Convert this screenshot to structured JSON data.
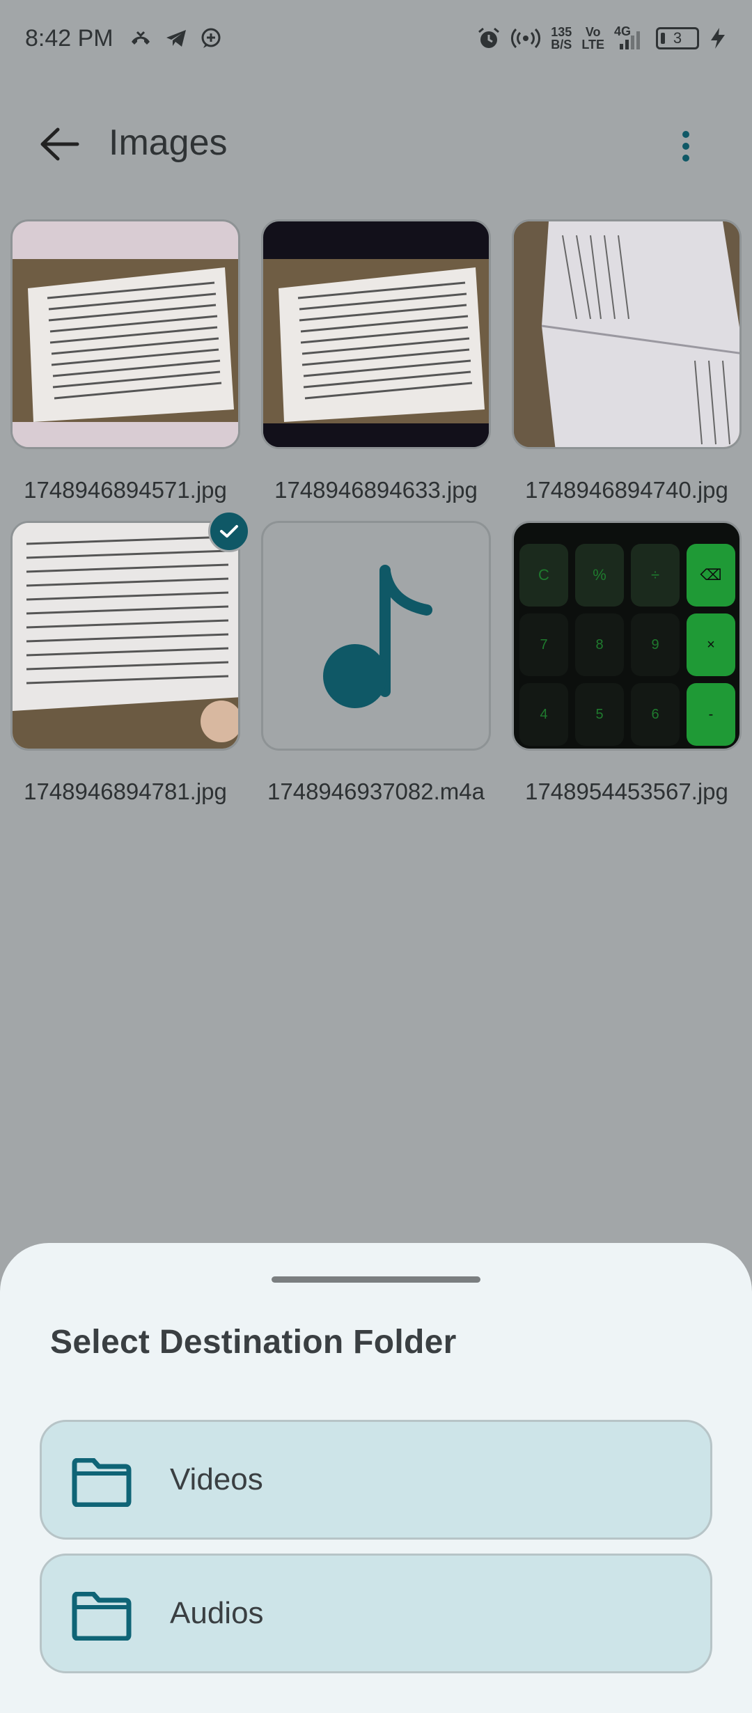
{
  "status_bar": {
    "time": "8:42 PM",
    "net_speed_value": "135",
    "net_speed_unit": "B/S",
    "volte_top": "Vo",
    "volte_bottom": "LTE",
    "network": "4G",
    "battery": "3"
  },
  "app_bar": {
    "title": "Images"
  },
  "files": [
    {
      "name": "1748946894571.jpg",
      "type": "image",
      "selected": false
    },
    {
      "name": "1748946894633.jpg",
      "type": "image",
      "selected": false
    },
    {
      "name": "1748946894740.jpg",
      "type": "image",
      "selected": false
    },
    {
      "name": "1748946894781.jpg",
      "type": "image",
      "selected": true
    },
    {
      "name": "1748946937082.m4a",
      "type": "audio",
      "selected": false
    },
    {
      "name": "1748954453567.jpg",
      "type": "image",
      "selected": false
    }
  ],
  "calculator_keys": [
    "C",
    "%",
    "÷",
    "⌫",
    "7",
    "8",
    "9",
    "×",
    "4",
    "5",
    "6",
    "-"
  ],
  "sheet": {
    "title": "Select Destination Folder",
    "folders": [
      {
        "label": "Videos",
        "icon": "folder-icon"
      },
      {
        "label": "Audios",
        "icon": "folder-icon"
      }
    ]
  },
  "colors": {
    "scrim_background": "#a2a6a8",
    "accent": "#0f5866",
    "sheet_background": "#eef4f6",
    "folder_row": "#cde4e8"
  }
}
